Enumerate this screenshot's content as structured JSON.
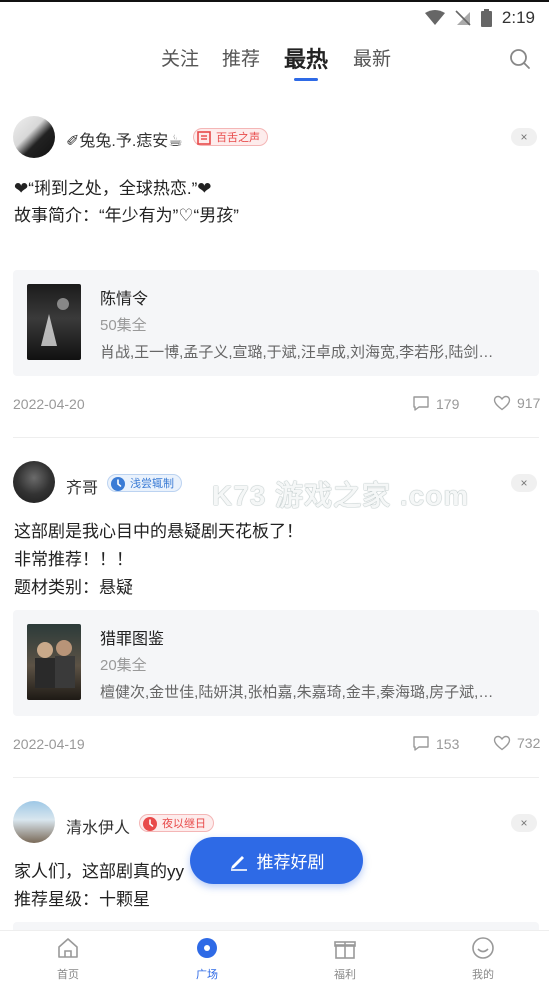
{
  "status_bar": {
    "time": "2:19"
  },
  "tabs": [
    {
      "label": "关注"
    },
    {
      "label": "推荐"
    },
    {
      "label": "最热"
    },
    {
      "label": "最新"
    }
  ],
  "posts": [
    {
      "username": "✐兔兔.予.痣安☕",
      "badge": "百舌之声",
      "line1": "❤“琍到之处，全球热恋.”❤",
      "line2": "故事简介：“年少有为”♡“男孩”",
      "card": {
        "title": "陈情令",
        "episodes": "50集全",
        "cast": "肖战,王一博,孟子义,宣璐,于斌,汪卓成,刘海宽,李若彤,陆剑…"
      },
      "date": "2022-04-20",
      "comments": "179",
      "likes": "917"
    },
    {
      "username": "齐哥",
      "badge": "浅尝辄制",
      "line1": "这部剧是我心目中的悬疑剧天花板了！",
      "line2": "非常推荐！！！",
      "line3": "题材类别：悬疑",
      "card": {
        "title": "猎罪图鉴",
        "episodes": "20集全",
        "cast": "檀健次,金世佳,陆妍淇,张柏嘉,朱嘉琦,金丰,秦海璐,房子斌,…"
      },
      "date": "2022-04-19",
      "comments": "153",
      "likes": "732"
    },
    {
      "username": "清水伊人",
      "badge": "夜以继日",
      "line1": "家人们，这部剧真的yy",
      "line2": "推荐星级：十颗星"
    }
  ],
  "close_label": "×",
  "fab_label": "推荐好剧",
  "watermark": "K73 游戏之家 .com",
  "bottom_nav": [
    {
      "label": "首页"
    },
    {
      "label": "广场"
    },
    {
      "label": "福利"
    },
    {
      "label": "我的"
    }
  ],
  "colors": {
    "accent": "#2e6ae6",
    "badge_red": "#e84a4a",
    "badge_blue": "#3a7bd5"
  }
}
